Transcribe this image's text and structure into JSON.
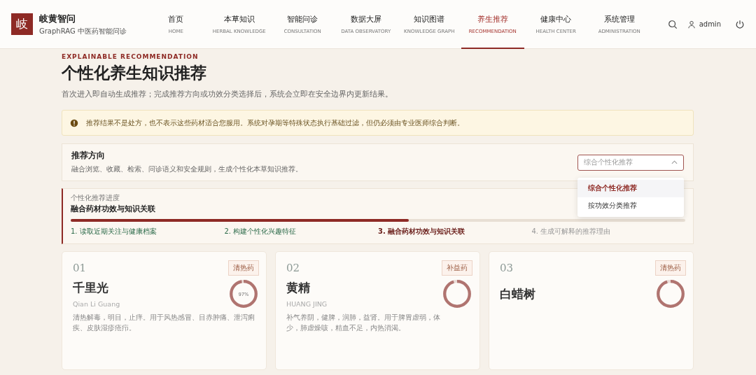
{
  "brand": {
    "logo": "岐",
    "name": "岐黄智问",
    "subtitle": "GraphRAG 中医药智能问诊"
  },
  "nav": [
    {
      "label": "首页",
      "sub": "HOME",
      "selected": false
    },
    {
      "label": "本草知识",
      "sub": "HERBAL KNOWLEDGE",
      "selected": false
    },
    {
      "label": "智能问诊",
      "sub": "CONSULTATION",
      "selected": false
    },
    {
      "label": "数据大屏",
      "sub": "DATA OBSERVATORY",
      "selected": false
    },
    {
      "label": "知识图谱",
      "sub": "KNOWLEDGE GRAPH",
      "selected": false
    },
    {
      "label": "养生推荐",
      "sub": "RECOMMENDATION",
      "selected": true
    },
    {
      "label": "健康中心",
      "sub": "HEALTH CENTER",
      "selected": false
    },
    {
      "label": "系统管理",
      "sub": "ADMINISTRATION",
      "selected": false
    }
  ],
  "user": "admin",
  "eyebrow": "EXPLAINABLE RECOMMENDATION",
  "title": "个性化养生知识推荐",
  "intro": "首次进入即自动生成推荐；完成推荐方向或功效分类选择后，系统会立即在安全边界内更新结果。",
  "notice": "推荐结果不是处方，也不表示这些药材适合您服用。系统对孕期等特殊状态执行基础过滤，但仍必须由专业医师综合判断。",
  "direction": {
    "title": "推荐方向",
    "desc": "融合浏览、收藏、检索、问诊语义和安全规则，生成个性化本草知识推荐。",
    "value": "综合个性化推荐",
    "options": [
      {
        "label": "综合个性化推荐",
        "selected": true
      },
      {
        "label": "按功效分类推荐",
        "selected": false
      }
    ]
  },
  "progress": {
    "caption": "个性化推荐进度",
    "title": "融合药材功效与知识关联",
    "level": 0.55,
    "steps": [
      {
        "label": "1. 读取近期关注与健康档案",
        "done": true,
        "selected": false
      },
      {
        "label": "2. 构建个性化兴趣特征",
        "done": true,
        "selected": false
      },
      {
        "label": "3. 融合药材功效与知识关联",
        "done": false,
        "selected": true
      },
      {
        "label": "4. 生成可解释的推荐理由",
        "done": false,
        "selected": false
      }
    ]
  },
  "cards": [
    {
      "index": "01",
      "tag": "清热药",
      "name": "千里光",
      "pinyin": "Qian Li Guang",
      "ring": {
        "level": 0.97,
        "label": "97%"
      },
      "desc": [
        "清热解毒，明目，止痒。用于风热感冒、目赤肿痛、泄泻痢疾、皮肤湿疹疮疖。"
      ]
    },
    {
      "index": "02",
      "tag": "补益药",
      "name": "黄精",
      "pinyin": "HUANG JING",
      "ring": {
        "level": 0.95
      },
      "desc": [
        "补气养阴，健脾，润肺，益肾。用于脾胃虚弱，体",
        "少，肺虚燥咳，精血不足，内热消渴。"
      ]
    },
    {
      "index": "03",
      "tag": "清热药",
      "name": "白蜡树",
      "ring": {
        "level": 0.95
      }
    }
  ]
}
